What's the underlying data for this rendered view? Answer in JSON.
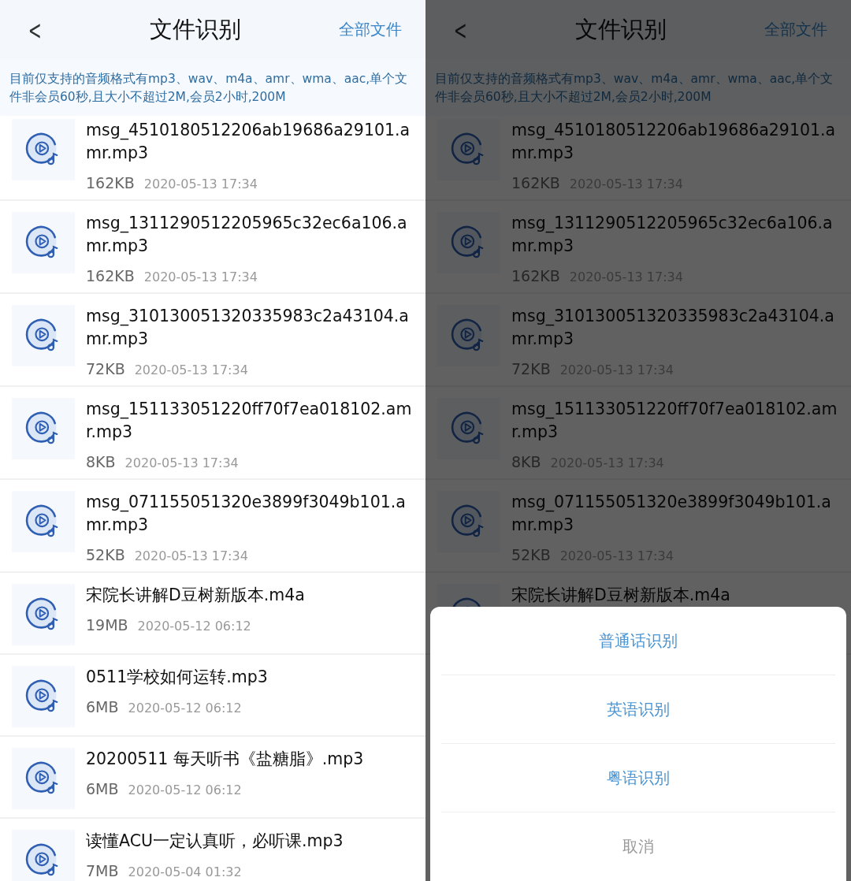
{
  "left_screen": {
    "header": {
      "back": "<",
      "title": "文件识别",
      "action": "全部文件"
    },
    "notice": "目前仅支持的音频格式有mp3、wav、m4a、amr、wma、aac,单个文件非会员60秒,且大小不超过2M,会员2小时,200M",
    "files": [
      {
        "name": "msg_4510180512206ab19686a29101.amr.mp3",
        "size": "162KB",
        "date": "2020-05-13 17:34"
      },
      {
        "name": "msg_1311290512205965c32ec6a106.amr.mp3",
        "size": "162KB",
        "date": "2020-05-13 17:34"
      },
      {
        "name": "msg_310130051320335983c2a43104.amr.mp3",
        "size": "72KB",
        "date": "2020-05-13 17:34"
      },
      {
        "name": "msg_151133051220ff70f7ea018102.amr.mp3",
        "size": "8KB",
        "date": "2020-05-13 17:34"
      },
      {
        "name": "msg_071155051320e3899f3049b101.amr.mp3",
        "size": "52KB",
        "date": "2020-05-13 17:34"
      },
      {
        "name": "宋院长讲解D豆树新版本.m4a",
        "size": "19MB",
        "date": "2020-05-12 06:12"
      },
      {
        "name": "0511学校如何运转.mp3",
        "size": "6MB",
        "date": "2020-05-12 06:12"
      },
      {
        "name": "20200511 每天听书《盐糖脂》.mp3",
        "size": "6MB",
        "date": "2020-05-12 06:12"
      },
      {
        "name": "读懂ACU一定认真听，必听课.mp3",
        "size": "7MB",
        "date": "2020-05-04 01:32"
      }
    ]
  },
  "right_screen": {
    "header": {
      "back": "<",
      "title": "文件识别",
      "action": "全部文件"
    },
    "notice": "目前仅支持的音频格式有mp3、wav、m4a、amr、wma、aac,单个文件非会员60秒,且大小不超过2M,会员2小时,200M",
    "files": [
      {
        "name": "msg_4510180512206ab19686a29101.amr.mp3",
        "size": "162KB",
        "date": "2020-05-13 17:34"
      },
      {
        "name": "msg_1311290512205965c32ec6a106.amr.mp3",
        "size": "162KB",
        "date": "2020-05-13 17:34"
      },
      {
        "name": "msg_310130051320335983c2a43104.amr.mp3",
        "size": "72KB",
        "date": "2020-05-13 17:34"
      },
      {
        "name": "msg_151133051220ff70f7ea018102.amr.mp3",
        "size": "8KB",
        "date": "2020-05-13 17:34"
      },
      {
        "name": "msg_071155051320e3899f3049b101.amr.mp3",
        "size": "52KB",
        "date": "2020-05-13 17:34"
      },
      {
        "name": "宋院长讲解D豆树新版本.m4a"
      }
    ],
    "action_sheet": {
      "options": [
        "普通话识别",
        "英语识别",
        "粤语识别"
      ],
      "cancel": "取消"
    }
  }
}
